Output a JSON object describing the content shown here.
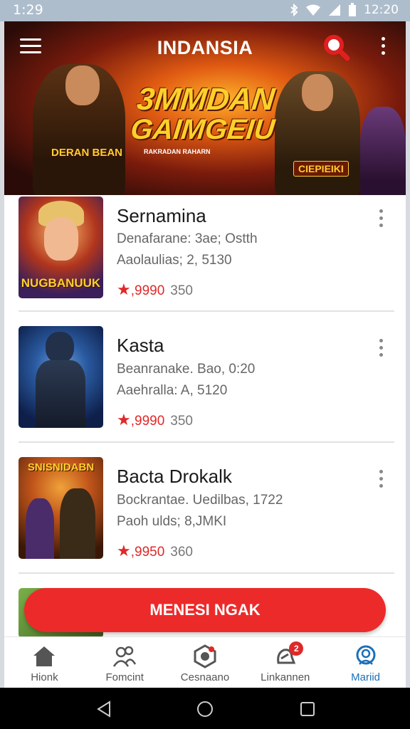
{
  "status": {
    "time": "1:29",
    "right_time": "12:20"
  },
  "header": {
    "title": "INDANSIA"
  },
  "banner": {
    "headline_line1": "3MMDAN",
    "headline_line2": "GAIMGEIU",
    "subtitle": "RAKRADAN RAHARN",
    "left_label": "DERAN BEAN",
    "right_label": "CIEPIEIKI"
  },
  "games": [
    {
      "title": "Sernamina",
      "meta1": "Denafarane: 3ae; Ostth",
      "meta2": "Aaolaulias; 2, 5130",
      "rating": ",9990",
      "count": "350",
      "thumb_caption": "NUGBANUUK"
    },
    {
      "title": "Kasta",
      "meta1": "Beanranake. Bao, 0:20",
      "meta2": "Aaehralla: A, 5120",
      "rating": ",9990",
      "count": "350",
      "thumb_caption": ""
    },
    {
      "title": "Bacta Drokalk",
      "meta1": "Bockrantae. Uedilbas, 1722",
      "meta2": "Paoh ulds; 8,JMKI",
      "rating": ",9950",
      "count": "360",
      "thumb_caption": "SNISNIDABN"
    }
  ],
  "cta": {
    "label": "MENESI NGAK"
  },
  "nav": [
    {
      "label": "Hionk",
      "icon": "home-icon"
    },
    {
      "label": "Fomcint",
      "icon": "community-icon"
    },
    {
      "label": "Cesnaano",
      "icon": "games-icon"
    },
    {
      "label": "Linkannen",
      "icon": "notifications-icon",
      "badge": "2"
    },
    {
      "label": "Mariid",
      "icon": "profile-icon",
      "active": true
    }
  ],
  "colors": {
    "accent": "#ec2a2a",
    "active_nav": "#1c6fb8",
    "status_bar": "#aebdcc"
  }
}
